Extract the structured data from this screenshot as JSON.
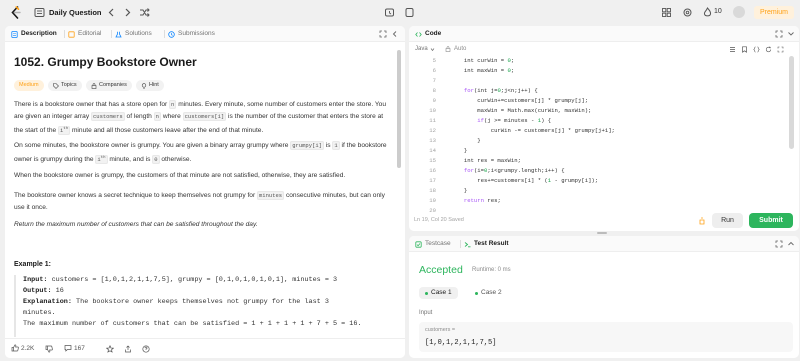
{
  "topbar": {
    "title": "Daily Question",
    "streak_count": "10",
    "premium_label": "Premium"
  },
  "left_panel": {
    "tabs": [
      {
        "label": "Description"
      },
      {
        "label": "Editorial"
      },
      {
        "label": "Solutions"
      },
      {
        "label": "Submissions"
      }
    ],
    "problem_title": "1052. Grumpy Bookstore Owner",
    "chips": {
      "difficulty": "Medium",
      "topics": "Topics",
      "companies": "Companies",
      "hint": "Hint"
    },
    "p1": {
      "a": "There is a bookstore owner that has a store open for ",
      "n": "n",
      "b": " minutes. Every minute, some number of customers enter the store. You are given an integer array ",
      "customers": "customers",
      "c": " of length ",
      "n2": "n",
      "d": " where ",
      "ci": "customers[i]",
      "e": " is the number of the customer that enters the store at the start of the ",
      "ith": "i",
      "th": "th",
      "f": " minute and all those customers leave after the end of that minute."
    },
    "p2": {
      "a": "On some minutes, the bookstore owner is grumpy. You are given a binary array grumpy where ",
      "gi": "grumpy[i]",
      "b": " is ",
      "one": "1",
      "c": " if the bookstore owner is grumpy during the ",
      "ith": "i",
      "th": "th",
      "d": " minute, and is ",
      "zero": "0",
      "e": " otherwise."
    },
    "p3": "When the bookstore owner is grumpy, the customers of that minute are not satisfied, otherwise, they are satisfied.",
    "p4": {
      "a": "The bookstore owner knows a secret technique to keep themselves not grumpy for ",
      "minutes": "minutes",
      "b": " consecutive minutes, but can only use it once."
    },
    "p5": "Return the maximum number of customers that can be satisfied throughout the day.",
    "example_title": "Example 1:",
    "example": {
      "input_label": "Input:",
      "input_value": " customers = [1,0,1,2,1,1,7,5], grumpy = [0,1,0,1,0,1,0,1], minutes = 3",
      "output_label": "Output:",
      "output_value": " 16",
      "explanation_label": "Explanation:",
      "explanation_value": " The bookstore owner keeps themselves not grumpy for the last 3",
      "line4": "minutes.",
      "line5": "The maximum number of customers that can be satisfied = 1 + 1 + 1 + 1 + 7 + 5 = 16."
    },
    "bottom": {
      "likes": "2.2K",
      "comments": "167"
    }
  },
  "code_panel": {
    "tab_label": "Code",
    "language": "Java",
    "mode": "Auto",
    "lines": [
      {
        "n": "5",
        "segs": [
          [
            "",
            "        int "
          ],
          [
            "",
            "curWin = "
          ],
          [
            "num",
            "0"
          ],
          [
            "",
            ";"
          ]
        ]
      },
      {
        "n": "6",
        "segs": [
          [
            "",
            "        int "
          ],
          [
            "",
            "maxWin = "
          ],
          [
            "num",
            "0"
          ],
          [
            "",
            ";"
          ]
        ]
      },
      {
        "n": "7",
        "segs": []
      },
      {
        "n": "8",
        "segs": [
          [
            "",
            "        "
          ],
          [
            "kw",
            "for"
          ],
          [
            "",
            "(int j="
          ],
          [
            "num",
            "0"
          ],
          [
            "",
            ";j<n;j++) {"
          ]
        ]
      },
      {
        "n": "9",
        "segs": [
          [
            "",
            "            curWin+=customers[j] * grumpy[j];"
          ]
        ]
      },
      {
        "n": "10",
        "segs": [
          [
            "",
            "            maxWin = Math.max(curWin, maxWin);"
          ]
        ]
      },
      {
        "n": "11",
        "segs": [
          [
            "",
            "            "
          ],
          [
            "kw",
            "if"
          ],
          [
            "",
            "(j >= minutes - "
          ],
          [
            "num",
            "1"
          ],
          [
            "",
            ") {"
          ]
        ]
      },
      {
        "n": "12",
        "segs": [
          [
            "",
            "                curWin -= customers[j] * grumpy[j+1];"
          ]
        ]
      },
      {
        "n": "13",
        "segs": [
          [
            "",
            "            }"
          ]
        ]
      },
      {
        "n": "14",
        "segs": [
          [
            "",
            "        }"
          ]
        ]
      },
      {
        "n": "15",
        "segs": [
          [
            "",
            "        int res = maxWin;"
          ]
        ]
      },
      {
        "n": "16",
        "segs": [
          [
            "",
            "        "
          ],
          [
            "kw",
            "for"
          ],
          [
            "",
            "(i="
          ],
          [
            "num",
            "0"
          ],
          [
            "",
            ";i<grumpy.length;i++) {"
          ]
        ]
      },
      {
        "n": "17",
        "segs": [
          [
            "",
            "            res+=customers[i] * ("
          ],
          [
            "num",
            "1"
          ],
          [
            "",
            " - grumpy[i]);"
          ]
        ]
      },
      {
        "n": "18",
        "segs": [
          [
            "",
            "        }"
          ]
        ]
      },
      {
        "n": "19",
        "segs": [
          [
            "",
            "        "
          ],
          [
            "kw",
            "return"
          ],
          [
            "",
            " res;"
          ]
        ]
      },
      {
        "n": "20",
        "segs": []
      }
    ],
    "status": "Ln 19, Col 20    Saved",
    "run_label": "Run",
    "submit_label": "Submit"
  },
  "result_panel": {
    "tabs": [
      {
        "label": "Testcase"
      },
      {
        "label": "Test Result"
      }
    ],
    "verdict": "Accepted",
    "runtime": "Runtime: 0 ms",
    "cases": [
      {
        "label": "Case 1"
      },
      {
        "label": "Case 2"
      }
    ],
    "input_label": "Input",
    "input_name": "customers =",
    "input_value": "[1,0,1,2,1,1,7,5]"
  },
  "colors": {
    "accent_green": "#2db55d",
    "premium_orange": "#ffa116",
    "keyword": "#a855f7",
    "number": "#16a34a"
  }
}
